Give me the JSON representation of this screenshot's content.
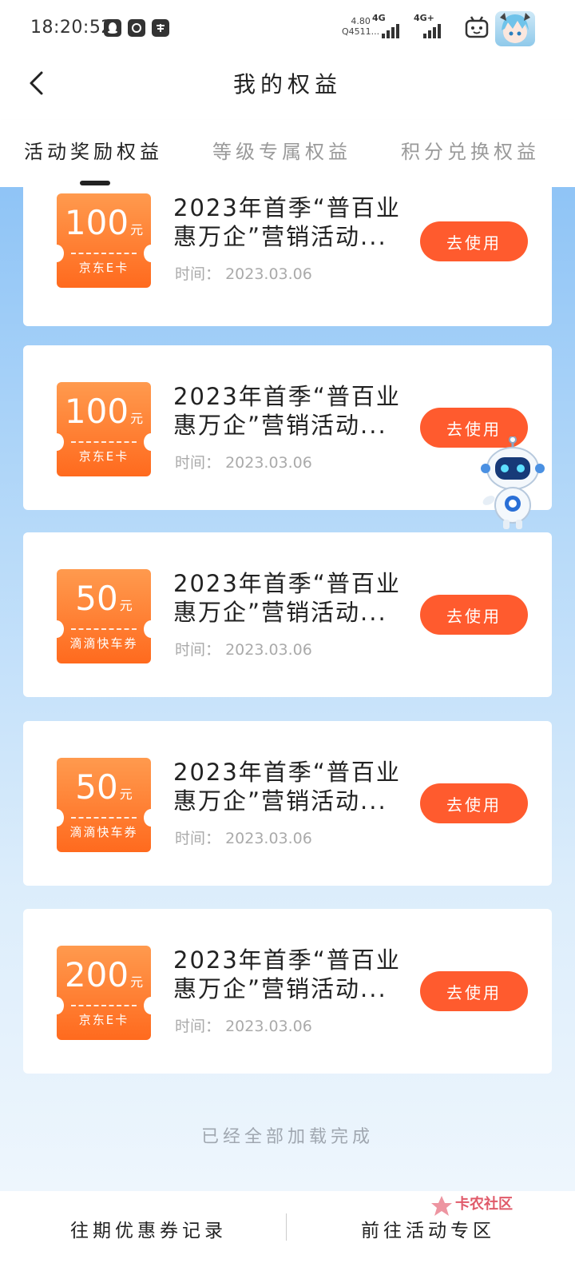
{
  "status": {
    "time": "18:20:52",
    "net_speed_value": "4.80",
    "net_speed_unit": "Q4511...",
    "signal1": "4G",
    "signal2": "4G+"
  },
  "header": {
    "title": "我的权益"
  },
  "tabs": [
    {
      "label": "活动奖励权益"
    },
    {
      "label": "等级专属权益"
    },
    {
      "label": "积分兑换权益"
    }
  ],
  "cards": [
    {
      "amount": "100",
      "unit": "元",
      "type": "京东E卡",
      "title": "2023年首季“普百业惠万企”营销活动...",
      "time_label": "时间：",
      "date": "2023.03.06",
      "button": "去使用"
    },
    {
      "amount": "100",
      "unit": "元",
      "type": "京东E卡",
      "title": "2023年首季“普百业惠万企”营销活动...",
      "time_label": "时间：",
      "date": "2023.03.06",
      "button": "去使用"
    },
    {
      "amount": "50",
      "unit": "元",
      "type": "滴滴快车券",
      "title": "2023年首季“普百业惠万企”营销活动...",
      "time_label": "时间：",
      "date": "2023.03.06",
      "button": "去使用"
    },
    {
      "amount": "50",
      "unit": "元",
      "type": "滴滴快车券",
      "title": "2023年首季“普百业惠万企”营销活动...",
      "time_label": "时间：",
      "date": "2023.03.06",
      "button": "去使用"
    },
    {
      "amount": "200",
      "unit": "元",
      "type": "京东E卡",
      "title": "2023年首季“普百业惠万企”营销活动...",
      "time_label": "时间：",
      "date": "2023.03.06",
      "button": "去使用"
    }
  ],
  "load_status": "已经全部加载完成",
  "bottom": {
    "left_link": "往期优惠券记录",
    "right_link": "前往活动专区",
    "watermark": "卡农社区"
  },
  "colors": {
    "accent": "#ff5b2e",
    "coupon_top": "#ff9a4e",
    "coupon_bottom": "#ff6a1e",
    "bg_gradient_top": "#8fc4f6"
  }
}
